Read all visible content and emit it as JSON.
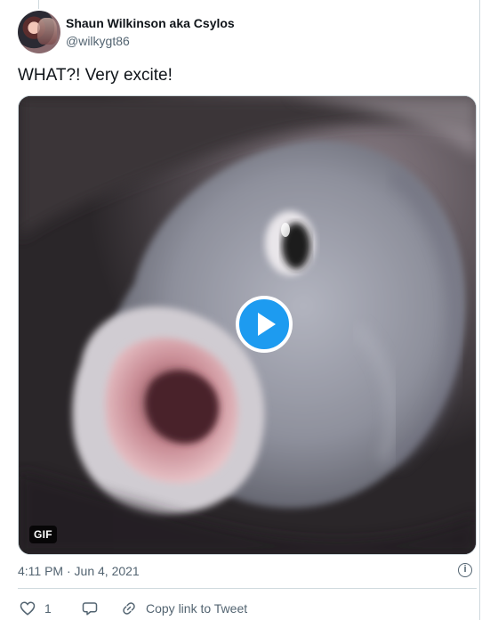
{
  "tweet": {
    "author": {
      "display_name": "Shaun Wilkinson aka Csylos",
      "handle": "@wilkygt86"
    },
    "text": "WHAT?! Very excite!",
    "media": {
      "type_badge": "GIF",
      "play_icon": "play-icon"
    },
    "timestamp": "4:11 PM · Jun 4, 2021",
    "info_icon": "info-icon",
    "actions": {
      "like_count": "1",
      "copy_link_label": "Copy link to Tweet"
    }
  },
  "colors": {
    "accent": "#1d9bf0",
    "secondary_text": "#536471",
    "border": "#cfd9de"
  }
}
